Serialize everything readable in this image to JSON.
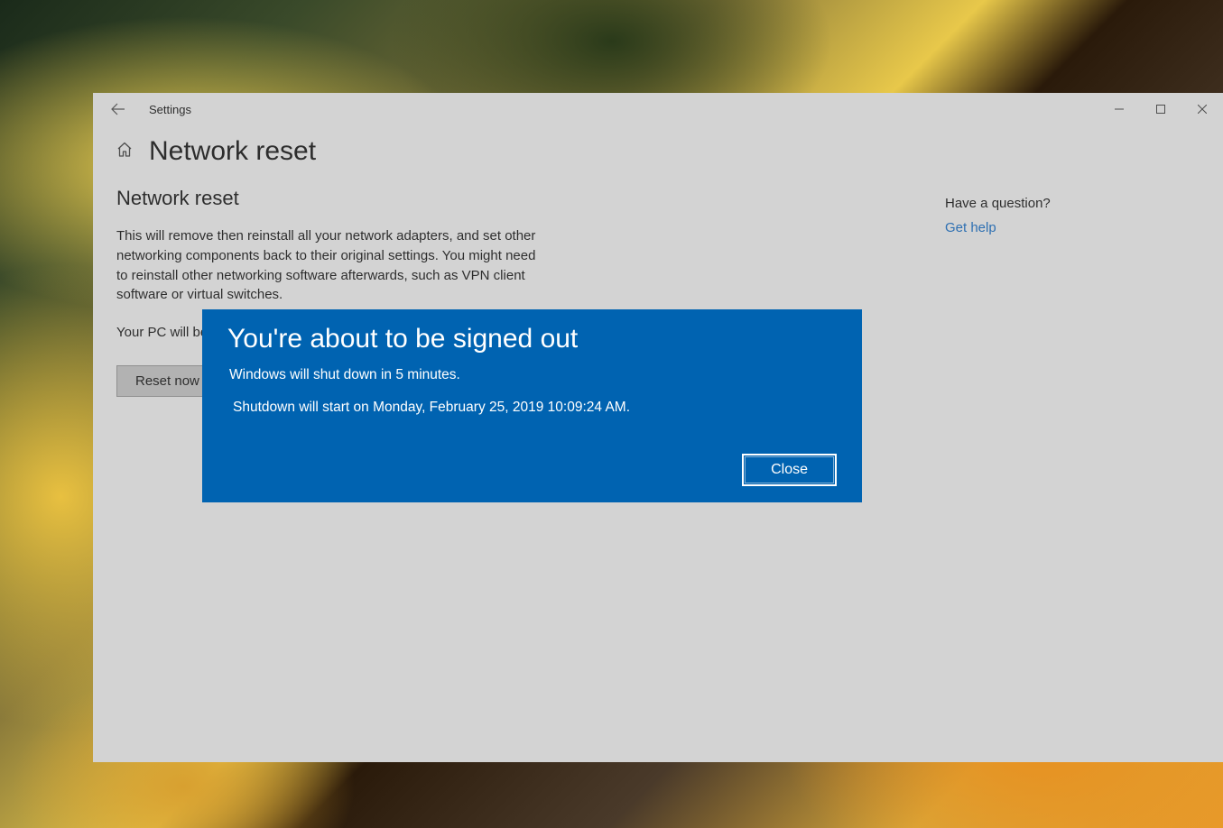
{
  "window": {
    "title": "Settings",
    "page_title": "Network reset"
  },
  "main": {
    "section_heading": "Network reset",
    "description": "This will remove then reinstall all your network adapters, and set other networking components back to their original settings. You might need to reinstall other networking software afterwards, such as VPN client software or virtual switches.",
    "restart_note": "Your PC will be restarted.",
    "reset_button": "Reset now"
  },
  "help": {
    "heading": "Have a question?",
    "link": "Get help"
  },
  "dialog": {
    "title": "You're about to be signed out",
    "line1": "Windows will shut down in 5 minutes.",
    "line2": "Shutdown will start on Monday, February 25, 2019 10:09:24 AM.",
    "close_button": "Close"
  }
}
